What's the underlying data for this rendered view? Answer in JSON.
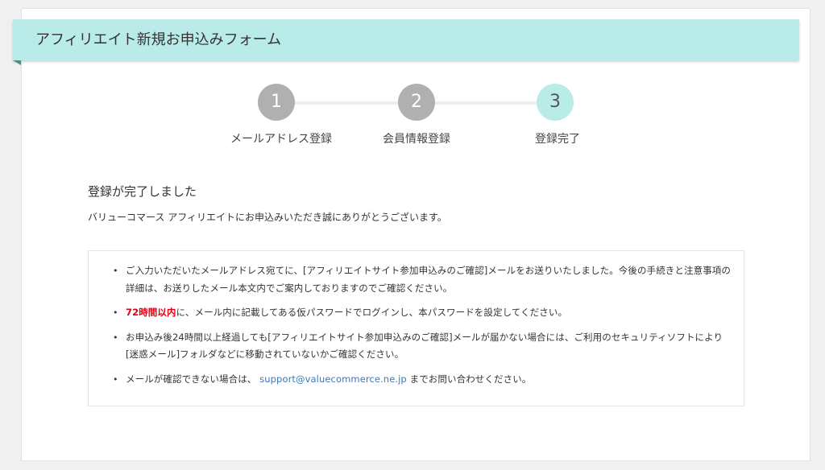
{
  "header": {
    "title": "アフィリエイト新規お申込みフォーム"
  },
  "steps": [
    {
      "number": "1",
      "label": "メールアドレス登録",
      "state": "done"
    },
    {
      "number": "2",
      "label": "会員情報登録",
      "state": "done"
    },
    {
      "number": "3",
      "label": "登録完了",
      "state": "current"
    }
  ],
  "main": {
    "heading": "登録が完了しました",
    "thanks": "バリューコマース アフィリエイトにお申込みいただき誠にありがとうございます。"
  },
  "notice": {
    "bullet": "•",
    "item1": "ご入力いただいたメールアドレス宛てに、[アフィリエイトサイト参加申込みのご確認]メールをお送りいたしました。今後の手続きと注意事項の詳細は、お送りしたメール本文内でご案内しておりますのでご確認ください。",
    "item2_highlight": "72時間以内",
    "item2_rest": "に、メール内に記載してある仮パスワードでログインし、本パスワードを設定してください。",
    "item3": "お申込み後24時間以上経過しても[アフィリエイトサイト参加申込みのご確認]メールが届かない場合には、ご利用のセキュリティソフトにより[迷惑メール]フォルダなどに移動されていないかご確認ください。",
    "item4_before": "メールが確認できない場合は、",
    "item4_link": "support@valuecommerce.ne.jp",
    "item4_after": "までお問い合わせください。"
  },
  "colors": {
    "header_bg": "#b9ebe9",
    "step_done": "#b0b0b0",
    "step_current": "#b9ebe9",
    "highlight": "#e60012",
    "link": "#3a78c0"
  }
}
